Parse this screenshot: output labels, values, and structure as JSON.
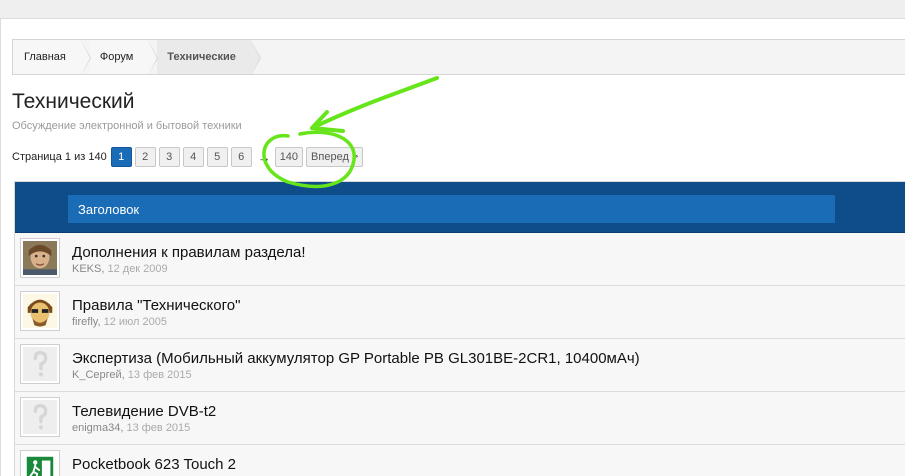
{
  "breadcrumb": [
    {
      "label": "Главная"
    },
    {
      "label": "Форум"
    },
    {
      "label": "Технические"
    }
  ],
  "forum": {
    "title": "Технический",
    "subtitle": "Обсуждение электронной и бытовой техники"
  },
  "pagination": {
    "label": "Страница 1 из 140",
    "pages": [
      "1",
      "2",
      "3",
      "4",
      "5",
      "6"
    ],
    "current": "1",
    "arrow": "→",
    "last": "140",
    "next": "Вперед >"
  },
  "table": {
    "header": "Заголовок"
  },
  "threads": [
    {
      "title": "Дополнения к правилам раздела!",
      "author": "KEKS",
      "date": "12 дек 2009",
      "avatar": "photo-avatar"
    },
    {
      "title": "Правила \"Технического\"",
      "author": "firefly",
      "date": "12 июл 2005",
      "avatar": "cartoon-avatar"
    },
    {
      "title": "Экспертиза (Мобильный аккумулятор GP Portable PB GL301BE-2CR1, 10400мАч)",
      "author": "K_Сергей",
      "date": "13 фев 2015",
      "avatar": "default-avatar"
    },
    {
      "title": "Телевидение DVB-t2",
      "author": "enigma34",
      "date": "13 фев 2015",
      "avatar": "default-avatar"
    },
    {
      "title": "Pocketbook 623 Touch 2",
      "author": "",
      "date": "",
      "avatar": "exit-sign-avatar"
    }
  ],
  "colors": {
    "accent": "#1b6cb6",
    "header_bg": "#0f4c8a",
    "annotation": "#66e61a"
  }
}
